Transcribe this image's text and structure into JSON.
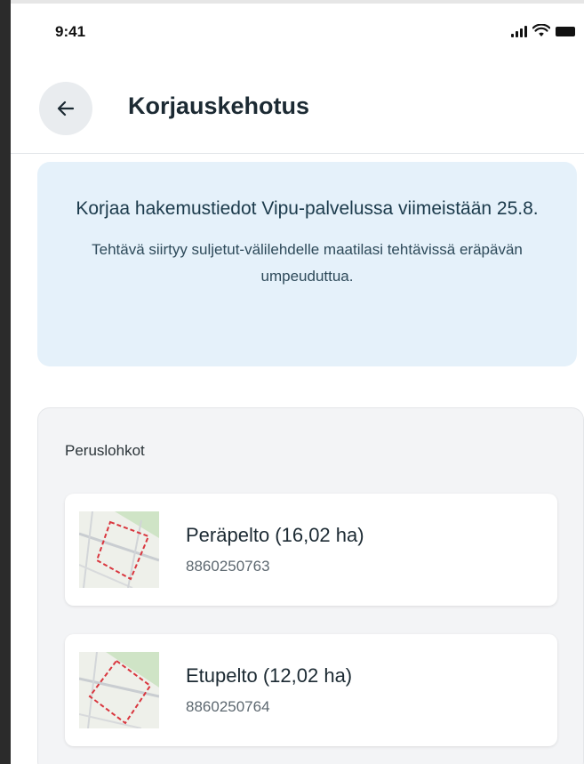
{
  "status_bar": {
    "time": "9:41"
  },
  "header": {
    "title": "Korjauskehotus"
  },
  "notice": {
    "title": "Korjaa hakemustiedot Vipu-palvelussa viimeistään 25.8.",
    "text": "Tehtävä siirtyy suljetut-välilehdelle maatilasi tehtävissä eräpävän umpeuduttua."
  },
  "parcels": {
    "label": "Peruslohkot",
    "items": [
      {
        "name": "Peräpelto (16,02 ha)",
        "id": "8860250763"
      },
      {
        "name": "Etupelto (12,02 ha)",
        "id": "8860250764"
      }
    ]
  },
  "colors": {
    "notice_bg": "#e5f1fa",
    "card_bg": "#f3f4f6",
    "parcel_outline": "#d9363e"
  }
}
